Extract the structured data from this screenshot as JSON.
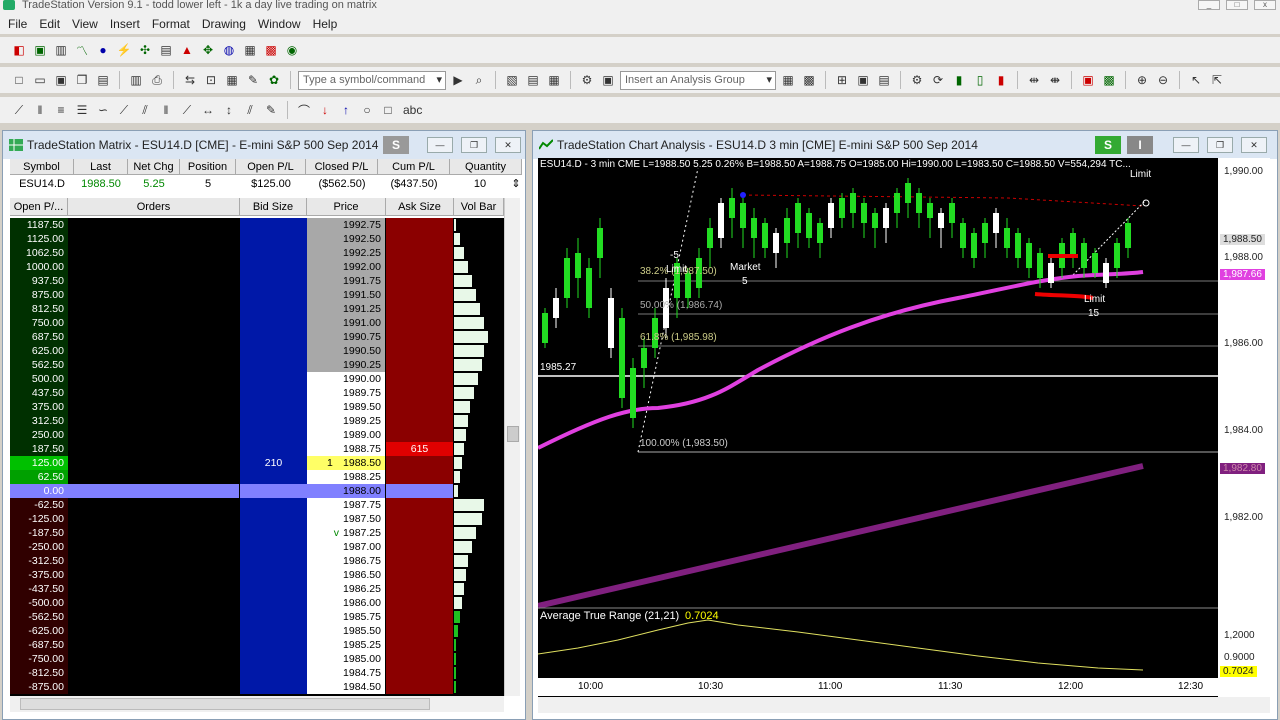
{
  "app": {
    "title": "TradeStation Version 9.1 - todd lower left - 1k a day live trading on matrix"
  },
  "menu": [
    "File",
    "Edit",
    "View",
    "Insert",
    "Format",
    "Drawing",
    "Window",
    "Help"
  ],
  "toolbar": {
    "symbol_placeholder": "Type a symbol/command",
    "analysis_group": "Insert an Analysis Group",
    "draw_text": "abc"
  },
  "matrix": {
    "title": "TradeStation Matrix - ESU14.D [CME] - E-mini S&P 500 Sep 2014",
    "s_badge": "S",
    "summary_headers": [
      "Symbol",
      "Last",
      "Net Chg",
      "Position",
      "Open P/L",
      "Closed P/L",
      "Cum P/L",
      "Quantity"
    ],
    "summary_values": [
      "ESU14.D",
      "1988.50",
      "5.25",
      "5",
      "$125.00",
      "($562.50)",
      "($437.50)",
      "10"
    ],
    "ladder_headers": [
      "Open P/...",
      "Orders",
      "Bid Size",
      "Price",
      "Ask Size",
      "Vol Bar"
    ],
    "rows": [
      {
        "pl": "1187.50",
        "price": "1992.75"
      },
      {
        "pl": "1125.00",
        "price": "1992.50"
      },
      {
        "pl": "1062.50",
        "price": "1992.25"
      },
      {
        "pl": "1000.00",
        "price": "1992.00"
      },
      {
        "pl": "937.50",
        "price": "1991.75"
      },
      {
        "pl": "875.00",
        "price": "1991.50"
      },
      {
        "pl": "812.50",
        "price": "1991.25"
      },
      {
        "pl": "750.00",
        "price": "1991.00"
      },
      {
        "pl": "687.50",
        "price": "1990.75"
      },
      {
        "pl": "625.00",
        "price": "1990.50"
      },
      {
        "pl": "562.50",
        "price": "1990.25"
      },
      {
        "pl": "500.00",
        "price": "1990.00"
      },
      {
        "pl": "437.50",
        "price": "1989.75"
      },
      {
        "pl": "375.00",
        "price": "1989.50"
      },
      {
        "pl": "312.50",
        "price": "1989.25"
      },
      {
        "pl": "250.00",
        "price": "1989.00"
      },
      {
        "pl": "187.50",
        "price": "1988.75",
        "ask": "615"
      },
      {
        "pl": "125.00",
        "price": "1988.50",
        "bid": "210",
        "pos": "1"
      },
      {
        "pl": "62.50",
        "price": "1988.25"
      },
      {
        "pl": "0.00",
        "price": "1988.00"
      },
      {
        "pl": "-62.50",
        "price": "1987.75"
      },
      {
        "pl": "-125.00",
        "price": "1987.50"
      },
      {
        "pl": "-187.50",
        "price": "1987.25",
        "mark": "v"
      },
      {
        "pl": "-250.00",
        "price": "1987.00"
      },
      {
        "pl": "-312.50",
        "price": "1986.75"
      },
      {
        "pl": "-375.00",
        "price": "1986.50"
      },
      {
        "pl": "-437.50",
        "price": "1986.25"
      },
      {
        "pl": "-500.00",
        "price": "1986.00"
      },
      {
        "pl": "-562.50",
        "price": "1985.75"
      },
      {
        "pl": "-625.00",
        "price": "1985.50"
      },
      {
        "pl": "-687.50",
        "price": "1985.25"
      },
      {
        "pl": "-750.00",
        "price": "1985.00"
      },
      {
        "pl": "-812.50",
        "price": "1984.75"
      },
      {
        "pl": "-875.00",
        "price": "1984.50"
      }
    ]
  },
  "chart": {
    "title": "TradeStation Chart Analysis - ESU14.D 3 min [CME] E-mini S&P 500 Sep 2014",
    "s_badge": "S",
    "i_badge": "I",
    "data_line": "ESU14.D - 3 min   CME   L=1988.50   5.25   0.26%   B=1988.50  A=1988.75  O=1985.00  Hi=1990.00  L=1983.50  C=1988.50  V=554,294  TC...",
    "price_labels": [
      "1,990.00",
      "1,988.50",
      "1,988.00",
      "1,987.66",
      "1,986.00",
      "1,984.00",
      "1,982.80",
      "1,982.00",
      "1,2000",
      "0.9000",
      "0.7024"
    ],
    "time_labels": [
      "10:00",
      "10:30",
      "11:00",
      "11:30",
      "12:00",
      "12:30"
    ],
    "fib_levels": [
      "38.2% (1,987.50)",
      "50.00% (1,986.74)",
      "61.8% (1,985.98)",
      "100.00% (1,983.50)"
    ],
    "hline_label": "1985.27",
    "annotations": {
      "limit_top": "Limit",
      "limit_minus": "-5",
      "limit_mid": "Limit",
      "market": "Market",
      "market_qty": "5",
      "limit_bottom": "Limit",
      "limit_bottom_qty": "15"
    },
    "atr_label": "Average True Range (21,21)",
    "atr_value": "0.7024"
  }
}
